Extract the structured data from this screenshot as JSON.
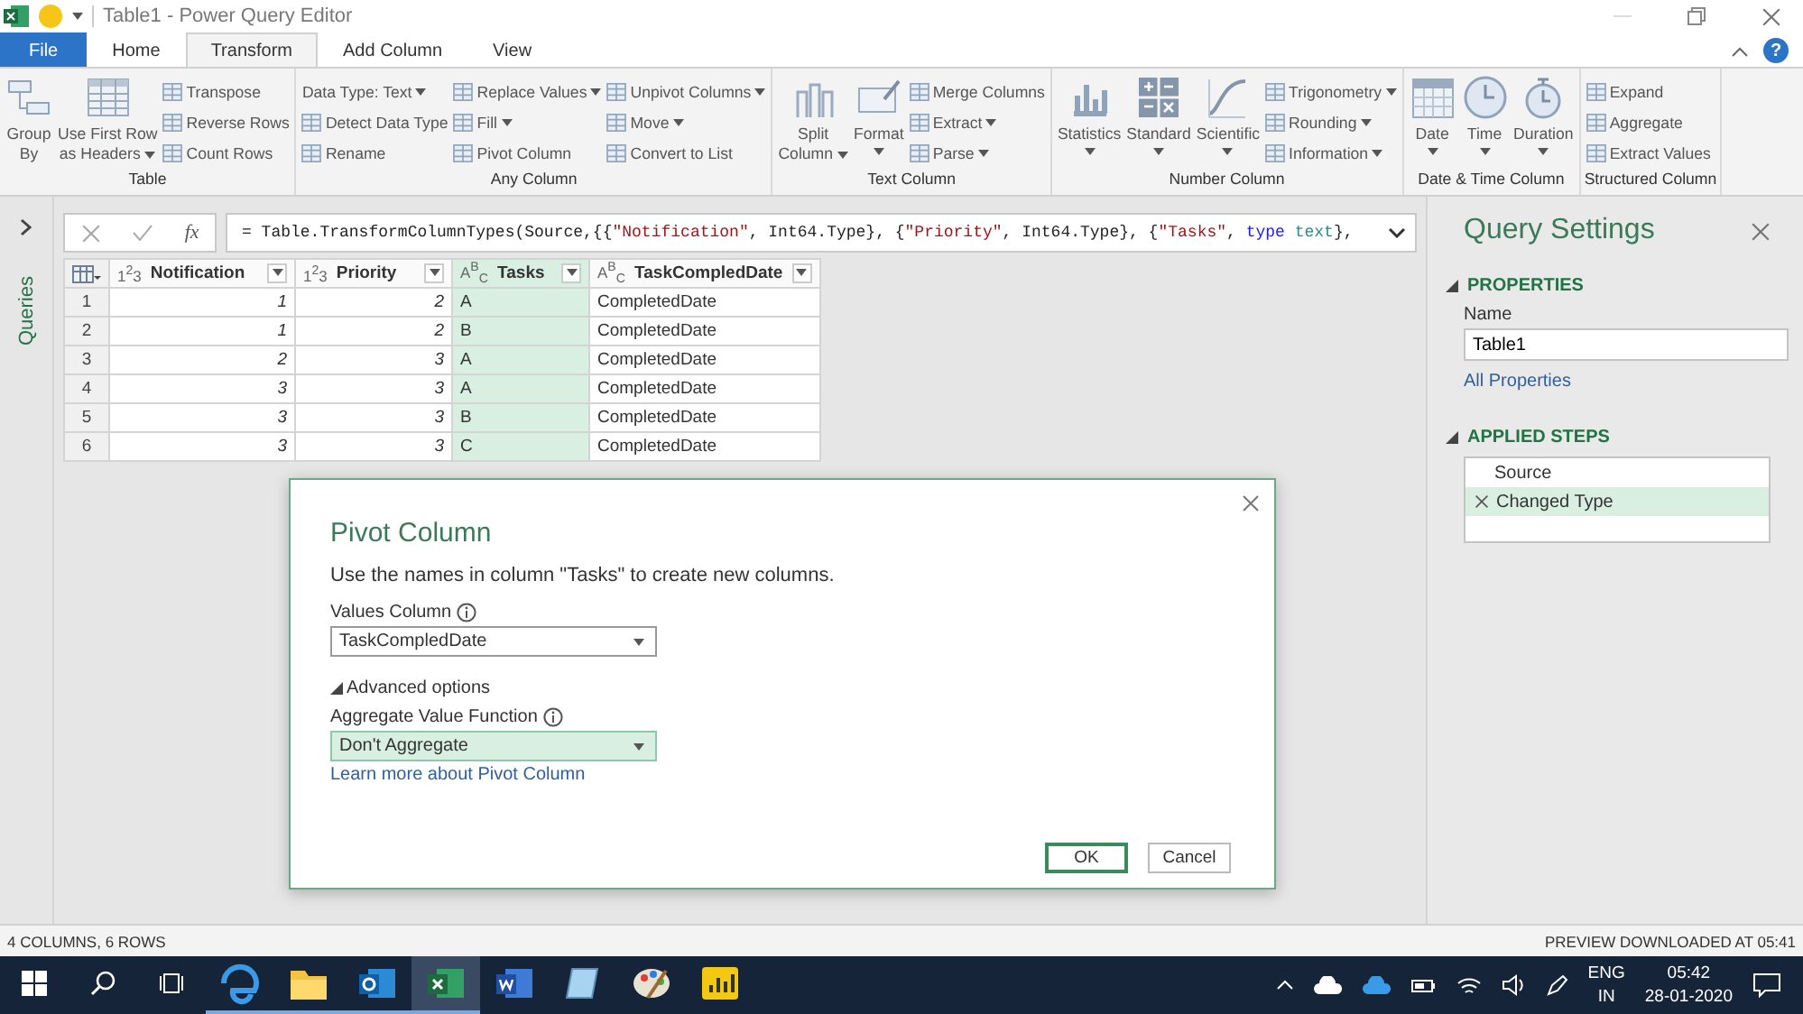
{
  "title_bar": {
    "title": "Table1 - Power Query Editor"
  },
  "ribbon_tabs": [
    {
      "label": "File",
      "kind": "file",
      "selected": false
    },
    {
      "label": "Home",
      "kind": "tab",
      "selected": false
    },
    {
      "label": "Transform",
      "kind": "tab",
      "selected": true
    },
    {
      "label": "Add Column",
      "kind": "tab",
      "selected": false
    },
    {
      "label": "View",
      "kind": "tab",
      "selected": false
    }
  ],
  "help": {
    "label": "?"
  },
  "ribbon_groups": [
    {
      "label": "Table",
      "columns": [
        {
          "kind": "large",
          "lines": [
            "Group",
            "By"
          ],
          "dropdown": false
        },
        {
          "kind": "large",
          "lines": [
            "Use First Row",
            "as Headers"
          ],
          "dropdown": true
        },
        {
          "kind": "stack",
          "items": [
            {
              "label": "Transpose",
              "kind": "button",
              "dropdown": false
            },
            {
              "label": "Reverse Rows",
              "kind": "button",
              "dropdown": false
            },
            {
              "label": "Count Rows",
              "kind": "button",
              "dropdown": false
            }
          ]
        }
      ]
    },
    {
      "label": "Any Column",
      "columns": [
        {
          "kind": "stack",
          "items": [
            {
              "label": "Data Type: Text",
              "kind": "text",
              "dropdown": true
            },
            {
              "label": "Detect Data Type",
              "kind": "button",
              "dropdown": false
            },
            {
              "label": "Rename",
              "kind": "button",
              "dropdown": false
            }
          ]
        },
        {
          "kind": "stack",
          "items": [
            {
              "label": "Replace Values",
              "kind": "button",
              "dropdown": true
            },
            {
              "label": "Fill",
              "kind": "button",
              "dropdown": true
            },
            {
              "label": "Pivot Column",
              "kind": "button",
              "dropdown": false
            }
          ]
        },
        {
          "kind": "stack",
          "items": [
            {
              "label": "Unpivot Columns",
              "kind": "button",
              "dropdown": true
            },
            {
              "label": "Move",
              "kind": "button",
              "dropdown": true
            },
            {
              "label": "Convert to List",
              "kind": "button",
              "dropdown": false
            }
          ]
        }
      ]
    },
    {
      "label": "Text Column",
      "columns": [
        {
          "kind": "large",
          "lines": [
            "Split",
            "Column"
          ],
          "dropdown": true
        },
        {
          "kind": "large",
          "lines": [
            "Format"
          ],
          "dropdown": true
        },
        {
          "kind": "stack",
          "items": [
            {
              "label": "Merge Columns",
              "kind": "button",
              "dropdown": false
            },
            {
              "label": "Extract",
              "kind": "button",
              "dropdown": true
            },
            {
              "label": "Parse",
              "kind": "button",
              "dropdown": true
            }
          ]
        }
      ]
    },
    {
      "label": "Number Column",
      "columns": [
        {
          "kind": "large",
          "lines": [
            "Statistics"
          ],
          "dropdown": true
        },
        {
          "kind": "large",
          "lines": [
            "Standard"
          ],
          "dropdown": true
        },
        {
          "kind": "large",
          "lines": [
            "Scientific"
          ],
          "dropdown": true
        },
        {
          "kind": "stack",
          "items": [
            {
              "label": "Trigonometry",
              "kind": "button",
              "dropdown": true
            },
            {
              "label": "Rounding",
              "kind": "button",
              "dropdown": true
            },
            {
              "label": "Information",
              "kind": "button",
              "dropdown": true
            }
          ]
        }
      ]
    },
    {
      "label": "Date & Time Column",
      "columns": [
        {
          "kind": "large",
          "lines": [
            "Date"
          ],
          "dropdown": true
        },
        {
          "kind": "large",
          "lines": [
            "Time"
          ],
          "dropdown": true
        },
        {
          "kind": "large",
          "lines": [
            "Duration"
          ],
          "dropdown": true
        }
      ]
    },
    {
      "label": "Structured Column",
      "columns": [
        {
          "kind": "stack",
          "items": [
            {
              "label": "Expand",
              "kind": "button",
              "dropdown": false
            },
            {
              "label": "Aggregate",
              "kind": "button",
              "dropdown": false
            },
            {
              "label": "Extract Values",
              "kind": "button",
              "dropdown": false
            }
          ]
        }
      ]
    }
  ],
  "queries_pane": {
    "label": "Queries"
  },
  "formula_bar": {
    "fx": "fx",
    "tokens": [
      {
        "text": "= Table.TransformColumnTypes(Source,{{",
        "kind": "code"
      },
      {
        "text": "\"Notification\"",
        "kind": "string"
      },
      {
        "text": ", Int64.Type}, {",
        "kind": "code"
      },
      {
        "text": "\"Priority\"",
        "kind": "string"
      },
      {
        "text": ", Int64.Type}, {",
        "kind": "code"
      },
      {
        "text": "\"Tasks\"",
        "kind": "string"
      },
      {
        "text": ", ",
        "kind": "code"
      },
      {
        "text": "type",
        "kind": "keyword"
      },
      {
        "text": " text",
        "kind": "typename"
      },
      {
        "text": "},",
        "kind": "code"
      }
    ]
  },
  "table": {
    "columns": [
      {
        "name": "Notification",
        "type_label": "1$^{2}$3",
        "kind": "number",
        "selected": false
      },
      {
        "name": "Priority",
        "type_label": "1$^{2}$3",
        "kind": "number",
        "selected": false
      },
      {
        "name": "Tasks",
        "type_label": "A$^{B}$$_{C}$",
        "kind": "text",
        "selected": true
      },
      {
        "name": "TaskCompledDate",
        "type_label": "A$^{B}$$_{C}$",
        "kind": "text",
        "selected": false
      }
    ],
    "rows": [
      {
        "number": "1",
        "cells": [
          "1",
          "2",
          "A",
          "CompletedDate"
        ]
      },
      {
        "number": "2",
        "cells": [
          "1",
          "2",
          "B",
          "CompletedDate"
        ]
      },
      {
        "number": "3",
        "cells": [
          "2",
          "3",
          "A",
          "CompletedDate"
        ]
      },
      {
        "number": "4",
        "cells": [
          "3",
          "3",
          "A",
          "CompletedDate"
        ]
      },
      {
        "number": "5",
        "cells": [
          "3",
          "3",
          "B",
          "CompletedDate"
        ]
      },
      {
        "number": "6",
        "cells": [
          "3",
          "3",
          "C",
          "CompletedDate"
        ]
      }
    ]
  },
  "query_settings": {
    "title": "Query Settings",
    "properties": {
      "heading": "PROPERTIES",
      "expanded": true,
      "name_label": "Name",
      "name_value": "Table1",
      "link": "All Properties"
    },
    "applied_steps": {
      "heading": "APPLIED STEPS",
      "expanded": true,
      "items": [
        {
          "label": "Source",
          "selected": false
        },
        {
          "label": "Changed Type",
          "selected": true
        }
      ]
    }
  },
  "dialog": {
    "title": "Pivot Column",
    "description": "Use the names in column \"Tasks\" to create new columns.",
    "values_label": "Values Column",
    "values_value": "TaskCompledDate",
    "advanced": {
      "label": "Advanced options",
      "expanded": true
    },
    "aggregate_label": "Aggregate Value Function",
    "aggregate_value": "Don't Aggregate",
    "aggregate_focused": true,
    "link": "Learn more about Pivot Column",
    "buttons": [
      {
        "label": "OK",
        "kind": "primary"
      },
      {
        "label": "Cancel",
        "kind": "secondary"
      }
    ]
  },
  "status_bar": {
    "left": "4 COLUMNS, 6 ROWS",
    "right": "PREVIEW DOWNLOADED AT 05:41"
  },
  "taskbar": {
    "apps": [
      {
        "kind": "browser",
        "running": true,
        "selected": false
      },
      {
        "kind": "folder",
        "running": true,
        "selected": false
      },
      {
        "kind": "mail",
        "running": true,
        "selected": false
      },
      {
        "kind": "spreadsheet",
        "running": true,
        "selected": true
      },
      {
        "kind": "document",
        "running": false,
        "selected": false
      },
      {
        "kind": "notepad",
        "running": false,
        "selected": false
      },
      {
        "kind": "paint",
        "running": false,
        "selected": false
      },
      {
        "kind": "chart",
        "running": false,
        "selected": false
      }
    ],
    "language": [
      "ENG",
      "IN"
    ],
    "time": "05:42",
    "date": "28-01-2020"
  }
}
